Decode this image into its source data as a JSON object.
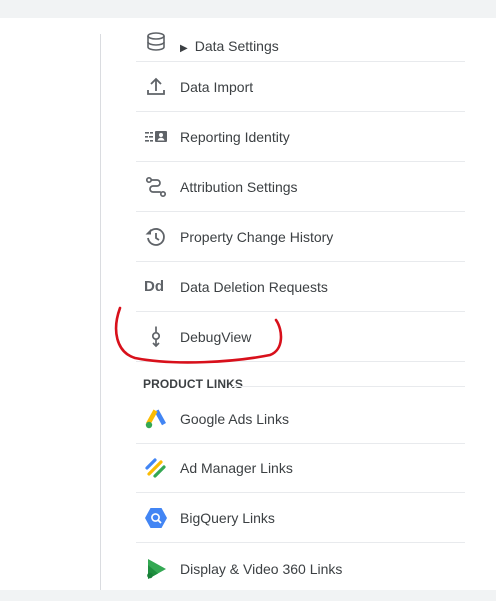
{
  "menu": {
    "items": [
      {
        "label": "Data Settings",
        "icon": "database-icon"
      },
      {
        "label": "Data Import",
        "icon": "upload-icon"
      },
      {
        "label": "Reporting Identity",
        "icon": "identity-icon"
      },
      {
        "label": "Attribution Settings",
        "icon": "attribution-icon"
      },
      {
        "label": "Property Change History",
        "icon": "history-icon"
      },
      {
        "label": "Data Deletion Requests",
        "icon": "deletion-icon",
        "glyph": "Dd"
      },
      {
        "label": "DebugView",
        "icon": "debug-icon"
      }
    ]
  },
  "product_links": {
    "heading": "PRODUCT LINKS",
    "items": [
      {
        "label": "Google Ads Links",
        "icon": "google-ads-icon"
      },
      {
        "label": "Ad Manager Links",
        "icon": "ad-manager-icon"
      },
      {
        "label": "BigQuery Links",
        "icon": "bigquery-icon"
      },
      {
        "label": "Display & Video 360 Links",
        "icon": "display-video-360-icon"
      }
    ]
  },
  "colors": {
    "icon_gray": "#5f6368",
    "annotation_red": "#d8101b",
    "google_blue": "#4285f4",
    "google_yellow": "#fbbc04",
    "google_green": "#34a853"
  }
}
